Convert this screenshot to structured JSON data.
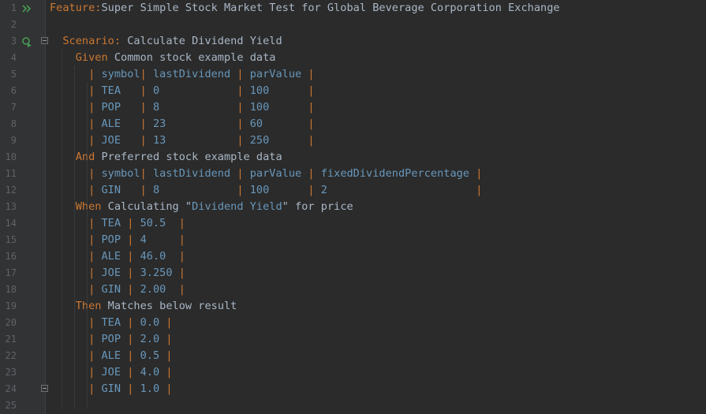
{
  "editor": {
    "lines": [
      {
        "num": "1",
        "indent": 0,
        "tokens": [
          {
            "t": "Feature:",
            "c": "kw"
          },
          {
            "t": "Super Simple Stock Market Test for Global Beverage Corporation Exchange",
            "c": "txt"
          }
        ],
        "icon": "run-all-icon"
      },
      {
        "num": "2",
        "indent": 0,
        "tokens": []
      },
      {
        "num": "3",
        "indent": 2,
        "tokens": [
          {
            "t": "Scenario:",
            "c": "kw"
          },
          {
            "t": " Calculate Dividend Yield",
            "c": "txt"
          }
        ],
        "icon": "run-scenario-icon",
        "fold": true
      },
      {
        "num": "4",
        "indent": 4,
        "tokens": [
          {
            "t": "Given",
            "c": "kw"
          },
          {
            "t": " Common stock example data",
            "c": "txt"
          }
        ]
      },
      {
        "num": "5",
        "indent": 6,
        "cells": [
          "symbol",
          "lastDividend",
          "parValue"
        ],
        "widths": [
          7,
          14,
          10
        ]
      },
      {
        "num": "6",
        "indent": 6,
        "cells": [
          "TEA",
          "0",
          "100"
        ],
        "widths": [
          7,
          14,
          10
        ]
      },
      {
        "num": "7",
        "indent": 6,
        "cells": [
          "POP",
          "8",
          "100"
        ],
        "widths": [
          7,
          14,
          10
        ]
      },
      {
        "num": "8",
        "indent": 6,
        "cells": [
          "ALE",
          "23",
          "60"
        ],
        "widths": [
          7,
          14,
          10
        ]
      },
      {
        "num": "9",
        "indent": 6,
        "cells": [
          "JOE",
          "13",
          "250"
        ],
        "widths": [
          7,
          14,
          10
        ]
      },
      {
        "num": "10",
        "indent": 4,
        "tokens": [
          {
            "t": "And",
            "c": "kw"
          },
          {
            "t": " Preferred stock example data",
            "c": "txt"
          }
        ]
      },
      {
        "num": "11",
        "indent": 6,
        "cells": [
          "symbol",
          "lastDividend",
          "parValue",
          "fixedDividendPercentage"
        ],
        "widths": [
          7,
          14,
          10,
          25
        ]
      },
      {
        "num": "12",
        "indent": 6,
        "cells": [
          "GIN",
          "8",
          "100",
          "2"
        ],
        "widths": [
          7,
          14,
          10,
          25
        ]
      },
      {
        "num": "13",
        "indent": 4,
        "tokens": [
          {
            "t": "When",
            "c": "kw"
          },
          {
            "t": " Calculating \"",
            "c": "txt"
          },
          {
            "t": "Dividend Yield",
            "c": "ph"
          },
          {
            "t": "\" for price",
            "c": "txt"
          }
        ]
      },
      {
        "num": "14",
        "indent": 6,
        "cells": [
          "TEA",
          "50.5"
        ],
        "widths": [
          5,
          7
        ]
      },
      {
        "num": "15",
        "indent": 6,
        "cells": [
          "POP",
          "4"
        ],
        "widths": [
          5,
          7
        ]
      },
      {
        "num": "16",
        "indent": 6,
        "cells": [
          "ALE",
          "46.0"
        ],
        "widths": [
          5,
          7
        ]
      },
      {
        "num": "17",
        "indent": 6,
        "cells": [
          "JOE",
          "3.250"
        ],
        "widths": [
          5,
          7
        ]
      },
      {
        "num": "18",
        "indent": 6,
        "cells": [
          "GIN",
          "2.00"
        ],
        "widths": [
          5,
          7
        ]
      },
      {
        "num": "19",
        "indent": 4,
        "tokens": [
          {
            "t": "Then",
            "c": "kw"
          },
          {
            "t": " Matches below result",
            "c": "txt"
          }
        ]
      },
      {
        "num": "20",
        "indent": 6,
        "cells": [
          "TEA",
          "0.0"
        ],
        "widths": [
          5,
          5
        ]
      },
      {
        "num": "21",
        "indent": 6,
        "cells": [
          "POP",
          "2.0"
        ],
        "widths": [
          5,
          5
        ]
      },
      {
        "num": "22",
        "indent": 6,
        "cells": [
          "ALE",
          "0.5"
        ],
        "widths": [
          5,
          5
        ]
      },
      {
        "num": "23",
        "indent": 6,
        "cells": [
          "JOE",
          "4.0"
        ],
        "widths": [
          5,
          5
        ]
      },
      {
        "num": "24",
        "indent": 6,
        "cells": [
          "GIN",
          "1.0"
        ],
        "widths": [
          5,
          5
        ],
        "fold": true
      },
      {
        "num": "25",
        "indent": 0,
        "tokens": []
      }
    ]
  },
  "colors": {
    "background": "#2b2b2b",
    "gutter": "#313335",
    "keyword": "#cc7832",
    "cell": "#6897bb",
    "text": "#a9b7c6",
    "line_number": "#606366"
  }
}
